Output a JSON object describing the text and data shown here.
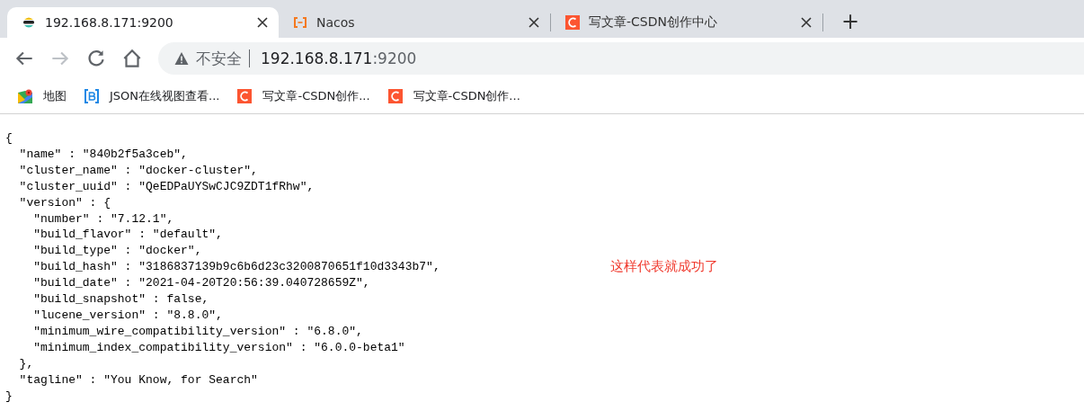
{
  "tabs": [
    {
      "title": "192.168.8.171:9200",
      "kind": "elastic",
      "selected": true
    },
    {
      "title": "Nacos",
      "kind": "nacos",
      "selected": false
    },
    {
      "title": "写文章-CSDN创作中心",
      "kind": "csdn",
      "selected": false
    }
  ],
  "new_tab": "+",
  "address": {
    "security": "不安全",
    "host": "192.168.8.171",
    "port": ":9200"
  },
  "bookmarks": [
    {
      "label": "地图",
      "kind": "maps"
    },
    {
      "label": "JSON在线视图查看...",
      "kind": "bejson"
    },
    {
      "label": "写文章-CSDN创作...",
      "kind": "csdn"
    },
    {
      "label": "写文章-CSDN创作...",
      "kind": "csdn"
    }
  ],
  "page": {
    "lines": [
      "{",
      "  \"name\" : \"840b2f5a3ceb\",",
      "  \"cluster_name\" : \"docker-cluster\",",
      "  \"cluster_uuid\" : \"QeEDPaUYSwCJC9ZDT1fRhw\",",
      "  \"version\" : {",
      "    \"number\" : \"7.12.1\",",
      "    \"build_flavor\" : \"default\",",
      "    \"build_type\" : \"docker\",",
      "    \"build_hash\" : \"3186837139b9c6b6d23c3200870651f10d3343b7\",",
      "    \"build_date\" : \"2021-04-20T20:56:39.040728659Z\",",
      "    \"build_snapshot\" : false,",
      "    \"lucene_version\" : \"8.8.0\",",
      "    \"minimum_wire_compatibility_version\" : \"6.8.0\",",
      "    \"minimum_index_compatibility_version\" : \"6.0.0-beta1\"",
      "  },",
      "  \"tagline\" : \"You Know, for Search\"",
      "}"
    ]
  },
  "annotation": "这样代表就成功了"
}
